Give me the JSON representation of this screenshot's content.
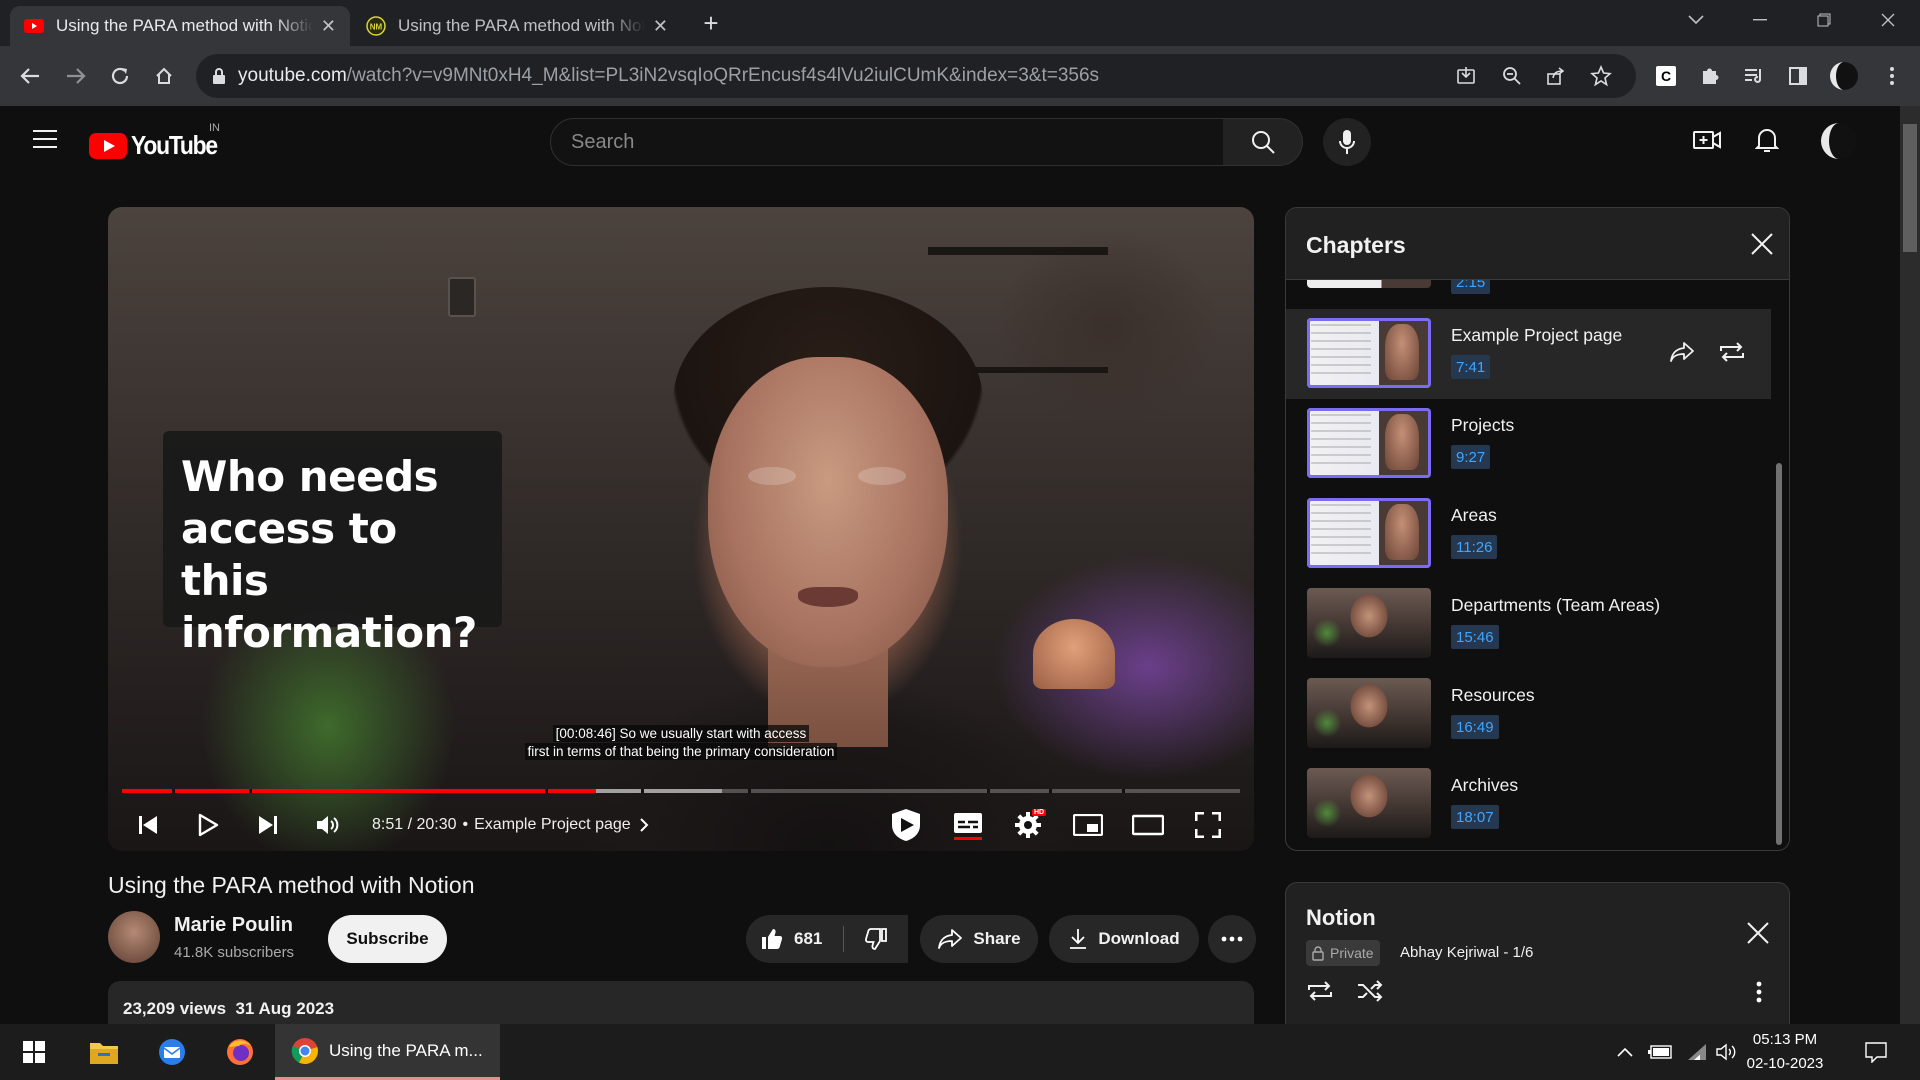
{
  "browser": {
    "tabs": [
      {
        "title": "Using the PARA method with Notion",
        "active": true
      },
      {
        "title": "Using the PARA method with Notion",
        "active": false
      }
    ],
    "url_host": "youtube.com",
    "url_path": "/watch?v=v9MNt0xH4_M&list=PL3iN2vsqIoQRrEncusf4s4lVu2iulCUmK&index=3&t=356s"
  },
  "youtube": {
    "logo_text": "YouTube",
    "region": "IN",
    "search_placeholder": "Search"
  },
  "video": {
    "overlay_lines": [
      "Who needs",
      "access to this",
      "information?"
    ],
    "caption_line1": "[00:08:46] So we usually start with access",
    "caption_line2": "first in terms of that being the primary consideration",
    "time": "8:51 / 20:30",
    "chapter_sep": "•",
    "chapter": "Example Project page",
    "progress_fraction": 0.424,
    "hd_badge": "HD",
    "title": "Using the PARA method with Notion",
    "channel": "Marie Poulin",
    "subscribers": "41.8K subscribers",
    "subscribe_label": "Subscribe",
    "likes": "681",
    "share_label": "Share",
    "download_label": "Download",
    "views_date": "23,209 views  31 Aug 2023"
  },
  "chapters": {
    "title": "Chapters",
    "partial_time": "2:15",
    "items": [
      {
        "title": "Example Project page",
        "time": "7:41"
      },
      {
        "title": "Projects",
        "time": "9:27"
      },
      {
        "title": "Areas",
        "time": "11:26"
      },
      {
        "title": "Departments (Team Areas)",
        "time": "15:46"
      },
      {
        "title": "Resources",
        "time": "16:49"
      },
      {
        "title": "Archives",
        "time": "18:07"
      }
    ]
  },
  "playlist": {
    "title": "Notion",
    "privacy": "Private",
    "owner": "Abhay Kejriwal - 1/6"
  },
  "taskbar": {
    "chrome_task": "Using the PARA m...",
    "time": "05:13 PM",
    "date": "02-10-2023"
  },
  "colors": {
    "youtube_red": "#ff0000",
    "chapter_time_blue": "#3ea6ff",
    "active_chapter_bg": "#272727"
  }
}
